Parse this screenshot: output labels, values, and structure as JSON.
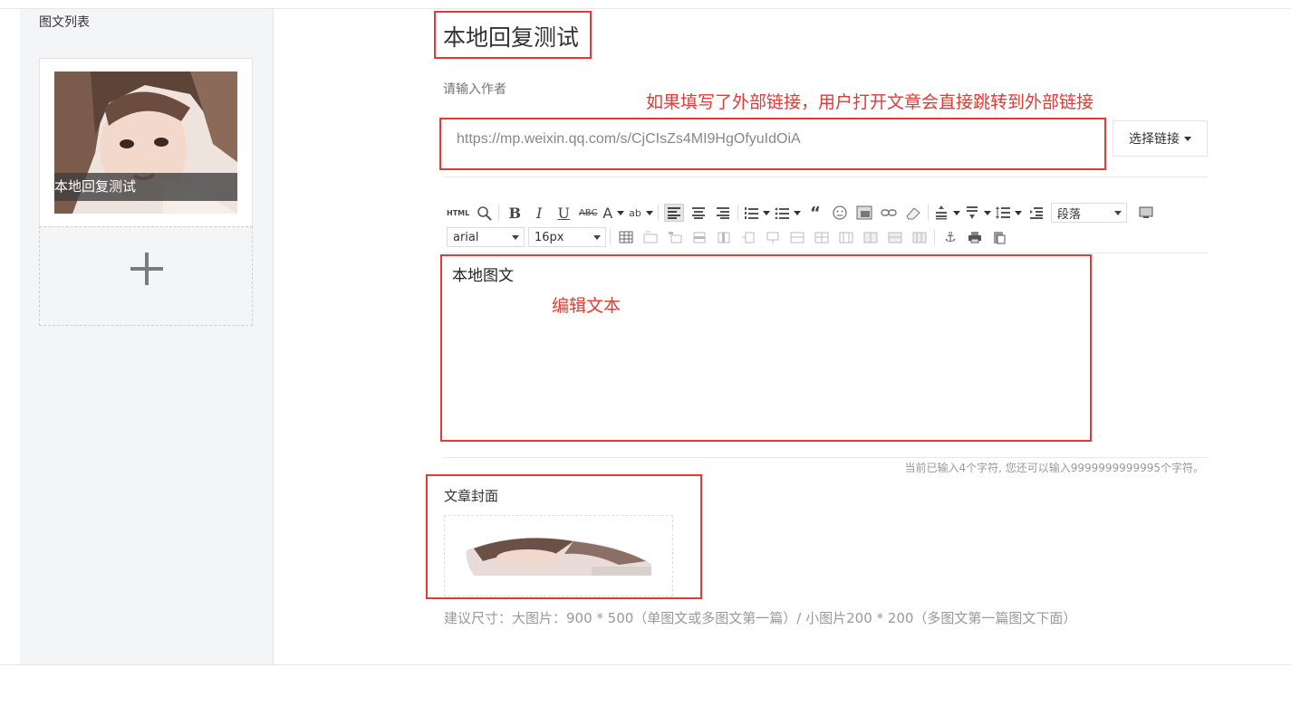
{
  "sidebar": {
    "title": "图文列表",
    "article_caption": "本地回复测试"
  },
  "main": {
    "title_value": "本地回复测试",
    "author_placeholder": "请输入作者",
    "link_note": "如果填写了外部链接，用户打开文章会直接跳转到外部链接",
    "url_value": "https://mp.weixin.qq.com/s/CjCIsZs4MI9HgOfyuIdOiA",
    "select_link_label": "选择链接",
    "editor": {
      "content": "本地图文",
      "note": "编辑文本",
      "paragraph_select": "段落",
      "font_family": "arial",
      "font_size": "16px",
      "html_label": "HTML"
    },
    "char_count": "当前已输入4个字符, 您还可以输入9999999999995个字符。",
    "cover_label": "文章封面",
    "size_hint": "建议尺寸：大图片：900 * 500（单图文或多图文第一篇）/ 小图片200 * 200（多图文第一篇图文下面）"
  },
  "colors": {
    "annotation_red": "#e53935",
    "sidebar_bg": "#f4f5f7"
  }
}
